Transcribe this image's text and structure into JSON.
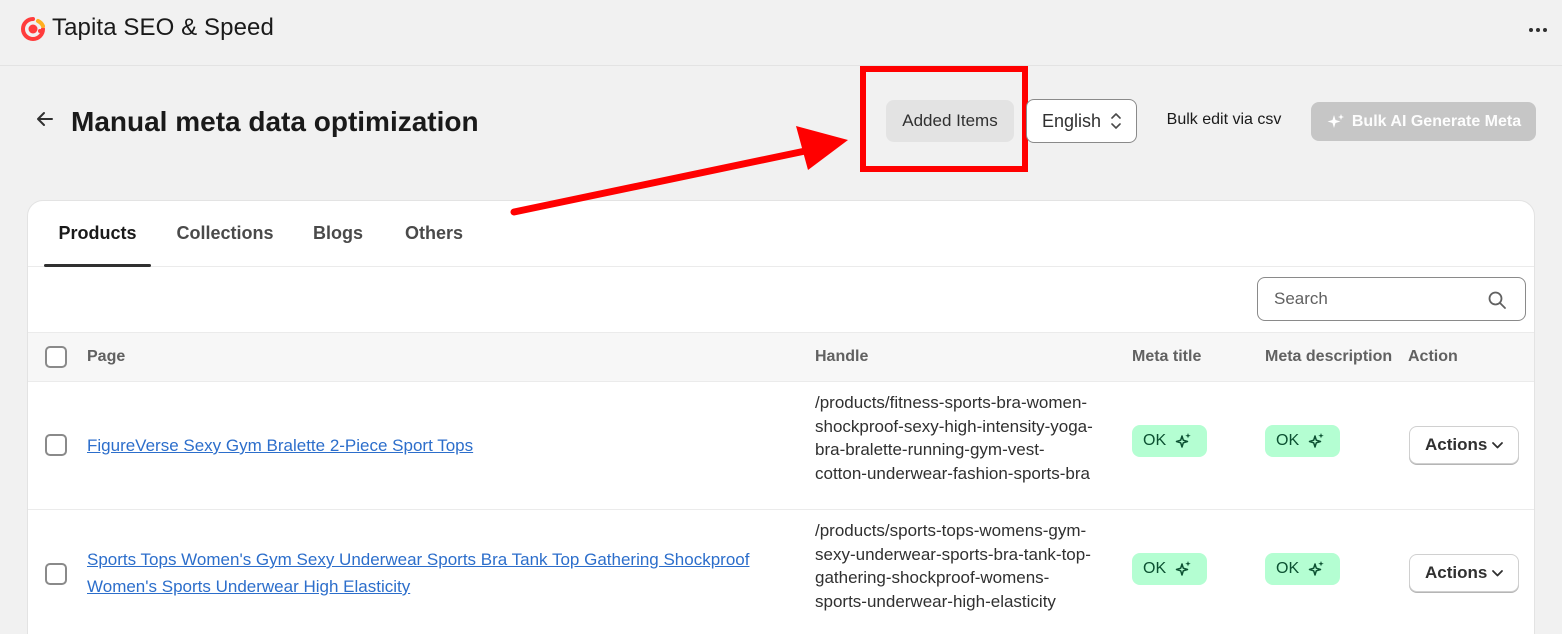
{
  "app": {
    "title": "Tapita SEO & Speed",
    "more_icon": "more-horizontal-icon",
    "logo_color": "#ff3c3c"
  },
  "page": {
    "title": "Manual meta data optimization",
    "back_icon": "arrow-left-icon"
  },
  "toolbar": {
    "added_items_label": "Added Items",
    "language_value": "English",
    "bulk_csv_label": "Bulk edit via csv",
    "bulk_ai_label": "Bulk AI Generate Meta",
    "bulk_ai_disabled": true
  },
  "annotation": {
    "highlight_color": "#ff0000"
  },
  "tabs": [
    {
      "label": "Products",
      "active": true
    },
    {
      "label": "Collections",
      "active": false
    },
    {
      "label": "Blogs",
      "active": false
    },
    {
      "label": "Others",
      "active": false
    }
  ],
  "search": {
    "placeholder": "Search",
    "icon": "search-icon"
  },
  "table": {
    "columns": [
      "Page",
      "Handle",
      "Meta title",
      "Meta description",
      "Action"
    ],
    "rows": [
      {
        "page_lines": [
          "FigureVerse Sexy Gym Bralette 2-Piece Sport Tops"
        ],
        "handle_lines": [
          "/products/fitness-sports-bra-women-",
          "shockproof-sexy-high-intensity-yoga-",
          "bra-bralette-running-gym-vest-",
          "cotton-underwear-fashion-sports-bra"
        ],
        "meta_title": "OK",
        "meta_description": "OK",
        "action": "Actions"
      },
      {
        "page_lines": [
          "Sports Tops Women's Gym Sexy Underwear Sports Bra Tank Top Gathering Shockproof ",
          "Women's Sports Underwear High Elasticity"
        ],
        "handle_lines": [
          "/products/sports-tops-womens-gym-",
          "sexy-underwear-sports-bra-tank-top-",
          "gathering-shockproof-womens-",
          "sports-underwear-high-elasticity"
        ],
        "meta_title": "OK",
        "meta_description": "OK",
        "action": "Actions"
      }
    ]
  },
  "colors": {
    "badge_bg": "#b4fed2",
    "badge_text": "#0c5132",
    "link": "#2c6ecb"
  }
}
